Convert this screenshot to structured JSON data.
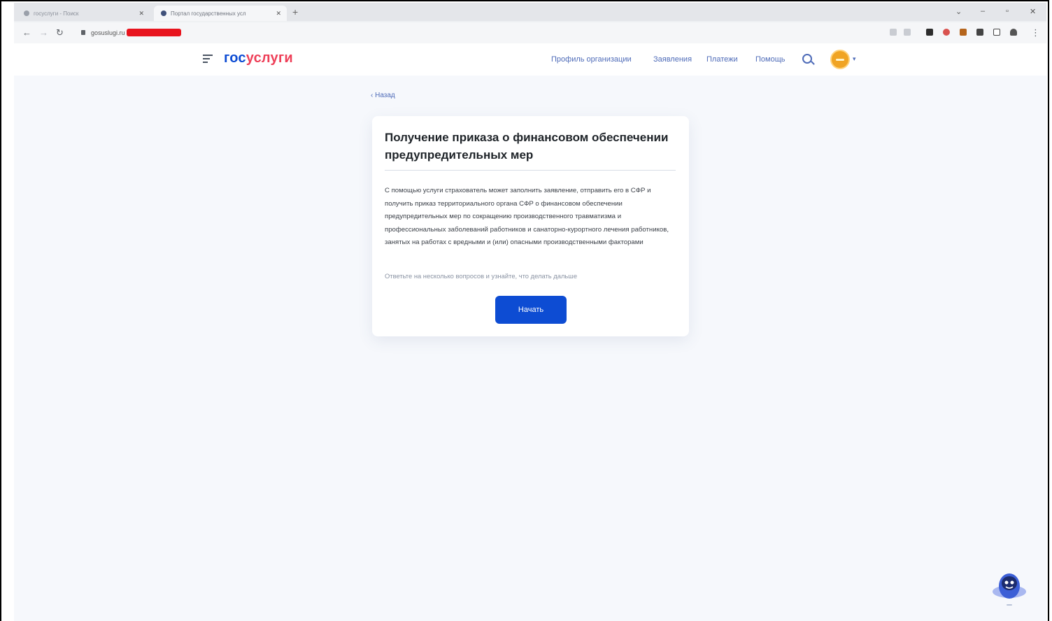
{
  "browser": {
    "tabs": [
      {
        "label": "госуслуги - Поиск",
        "active": false
      },
      {
        "label": "Портал государственных усл",
        "active": true
      }
    ],
    "new_tab": "+",
    "url": "gosuslugi.ru"
  },
  "site": {
    "logo_part1": "гос",
    "logo_part2": "услуги",
    "nav": [
      "Профиль организации",
      "Заявления",
      "Платежи",
      "Помощь"
    ]
  },
  "page": {
    "back_label": "‹  Назад",
    "title": "Получение приказа о финансовом обеспечении предупредительных мер",
    "description": "С помощью услуги страхователь может заполнить заявление, отправить его в СФР и получить приказ территориального органа СФР о финансовом обеспечении предупредительных мер по сокращению производственного травматизма и профессиональных заболеваний работников и санаторно-курортного лечения работников, занятых на работах с вредными и (или) опасными производственными факторами",
    "hint": "Ответьте на несколько вопросов и узнайте, что делать дальше",
    "start_button": "Начать"
  },
  "colors": {
    "brand_blue": "#0d4cd3",
    "brand_red": "#ee3f58",
    "page_bg": "#f6f8fc"
  }
}
